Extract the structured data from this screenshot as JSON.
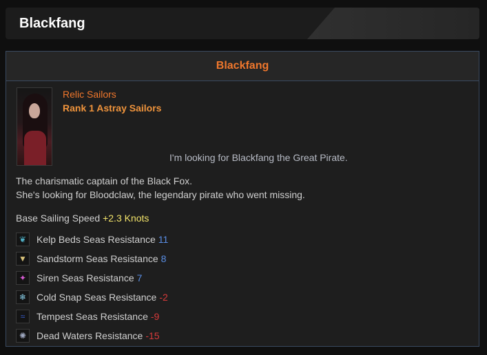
{
  "header": {
    "title": "Blackfang"
  },
  "card": {
    "title": "Blackfang",
    "type": "Relic Sailors",
    "rank": "Rank 1 Astray Sailors",
    "quote": "I'm looking for Blackfang the Great Pirate.",
    "description": [
      "The charismatic captain of the Black Fox.",
      "She's looking for Bloodclaw, the legendary pirate who went missing."
    ],
    "speed": {
      "label": "Base Sailing Speed",
      "value": "+2.3 Knots"
    },
    "resistances": [
      {
        "label": "Kelp Beds Seas Resistance",
        "value": "11",
        "icon": "kelp-icon",
        "glyph": "❦",
        "color": "#4fb0c6"
      },
      {
        "label": "Sandstorm Seas Resistance",
        "value": "8",
        "icon": "sandstorm-icon",
        "glyph": "▼",
        "color": "#d8c27a"
      },
      {
        "label": "Siren Seas Resistance",
        "value": "7",
        "icon": "siren-icon",
        "glyph": "✦",
        "color": "#d45ad0"
      },
      {
        "label": "Cold Snap Seas Resistance",
        "value": "-2",
        "icon": "cold-snap-icon",
        "glyph": "❄",
        "color": "#8ad0ea"
      },
      {
        "label": "Tempest Seas Resistance",
        "value": "-9",
        "icon": "tempest-icon",
        "glyph": "≈",
        "color": "#3a5fd0"
      },
      {
        "label": "Dead Waters Resistance",
        "value": "-15",
        "icon": "dead-waters-icon",
        "glyph": "✺",
        "color": "#9fa8c0"
      }
    ]
  }
}
